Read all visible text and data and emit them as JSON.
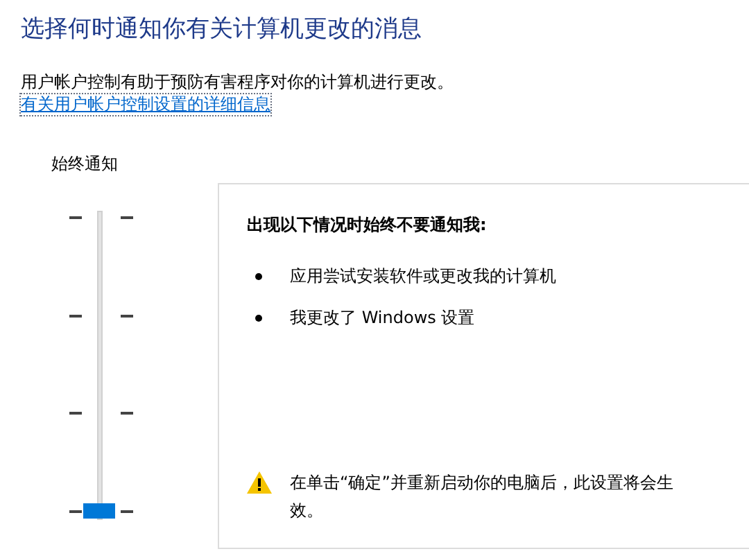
{
  "title": "选择何时通知你有关计算机更改的消息",
  "description": "用户帐户控制有助于预防有害程序对你的计算机进行更改。",
  "link": "有关用户帐户控制设置的详细信息",
  "slider": {
    "top_label": "始终通知",
    "level": 0
  },
  "panel": {
    "heading": "出现以下情况时始终不要通知我:",
    "bullets": [
      "应用尝试安装软件或更改我的计算机",
      "我更改了 Windows 设置"
    ],
    "warning": "在单击“确定”并重新启动你的电脑后，此设置将会生效。"
  }
}
